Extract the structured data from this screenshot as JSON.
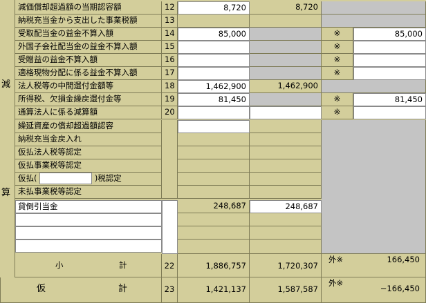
{
  "side_labels": [
    "減",
    "算"
  ],
  "rows": [
    {
      "label": "減価償却超過額の当期認容額",
      "no": "12",
      "total": "8,720",
      "retained": "8,720",
      "flag": "",
      "outflow": ""
    },
    {
      "label": "納税充当金から支出した事業税額",
      "no": "13",
      "total": "",
      "retained": "",
      "flag": "",
      "outflow": ""
    },
    {
      "label": "受取配当金の益金不算入額",
      "no": "14",
      "total": "85,000",
      "retained": "",
      "flag": "※",
      "outflow": "85,000"
    },
    {
      "label": "外国子会社配当金の益金不算入額",
      "no": "15",
      "total": "",
      "retained": "",
      "flag": "※",
      "outflow": ""
    },
    {
      "label": "受贈益の益金不算入額",
      "no": "16",
      "total": "",
      "retained": "",
      "flag": "※",
      "outflow": ""
    },
    {
      "label": "適格現物分配に係る益金不算入額",
      "no": "17",
      "total": "",
      "retained": "",
      "flag": "※",
      "outflow": ""
    },
    {
      "label": "法人税等の中間還付金額等",
      "no": "18",
      "total": "1,462,900",
      "retained": "1,462,900",
      "flag": "",
      "outflow": ""
    },
    {
      "label": "所得税、欠損金繰戻還付金等",
      "no": "19",
      "total": "81,450",
      "retained": "",
      "flag": "※",
      "outflow": "81,450"
    },
    {
      "label": "通算法人に係る減算額",
      "no": "20",
      "total": "",
      "retained": "",
      "flag": "※",
      "outflow": ""
    }
  ],
  "extra_rows": [
    "繰延資産の償却超過額認容",
    "納税充当金戻入れ",
    "仮払法人税等認定",
    "仮払事業税等認定"
  ],
  "karibarai": {
    "prefix": "仮払(",
    "value": "",
    "suffix": ")税認定"
  },
  "misc_row": "未払事業税等認定",
  "free_rows": [
    {
      "label": "貸倒引当金",
      "total": "248,687",
      "retained": "248,687"
    },
    {
      "label": "",
      "total": "",
      "retained": ""
    },
    {
      "label": "",
      "total": "",
      "retained": ""
    },
    {
      "label": "",
      "total": "",
      "retained": ""
    }
  ],
  "subtotal": {
    "label_a": "小",
    "label_b": "計",
    "no": "22",
    "total": "1,886,757",
    "retained": "1,720,307",
    "flag": "外※",
    "outflow": "166,450"
  },
  "provisional": {
    "label_a": "仮",
    "label_b": "計",
    "no": "23",
    "total": "1,421,137",
    "retained": "1,587,587",
    "flag": "外※",
    "outflow": "−166,450"
  }
}
